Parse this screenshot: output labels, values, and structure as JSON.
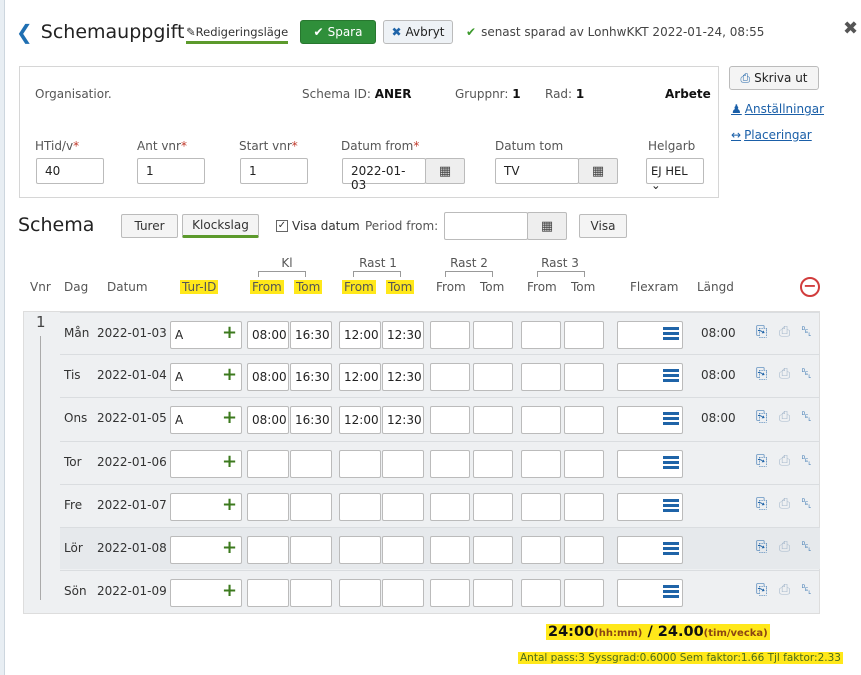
{
  "header": {
    "title": "Schemauppgift",
    "edit_mode": "Redigeringsläge",
    "save_label": "Spara",
    "cancel_label": "Avbryt",
    "saved_status": "senast sparad av LonhwKKT 2022-01-24, 08:55"
  },
  "info": {
    "org_label": "Organisatior.",
    "schema_id_label": "Schema ID:",
    "schema_id": "ANER",
    "gruppnr_label": "Gruppnr:",
    "gruppnr": "1",
    "rad_label": "Rad:",
    "rad": "1",
    "arbete": "Arbete",
    "htid_label": "HTid/v",
    "htid": "40",
    "antvnr_label": "Ant vnr",
    "antvnr": "1",
    "startvnr_label": "Start vnr",
    "startvnr": "1",
    "datum_from_label": "Datum from",
    "datum_from": "2022-01-03",
    "datum_tom_label": "Datum tom",
    "datum_tom": "TV",
    "helgarb_label": "Helgarb",
    "helgarb": "EJ HEL"
  },
  "side": {
    "print_label": "Skriva ut",
    "anst_label": "Anställningar",
    "plac_label": "Placeringar"
  },
  "schema": {
    "title": "Schema",
    "tab_turer": "Turer",
    "tab_klockslag": "Klockslag",
    "visa_datum": "Visa datum",
    "period_from": "Period from:",
    "visa_button": "Visa"
  },
  "columns": {
    "vnr": "Vnr",
    "dag": "Dag",
    "datum": "Datum",
    "turid": "Tur-ID",
    "kl": "Kl",
    "rast1": "Rast 1",
    "rast2": "Rast 2",
    "rast3": "Rast 3",
    "from": "From",
    "tom": "Tom",
    "flexram": "Flexram",
    "langd": "Längd"
  },
  "vnr_value": "1",
  "rows": [
    {
      "dag": "Mån",
      "datum": "2022-01-03",
      "tur": "A",
      "kl_from": "08:00",
      "kl_tom": "16:30",
      "r1_from": "12:00",
      "r1_tom": "12:30",
      "langd": "08:00"
    },
    {
      "dag": "Tis",
      "datum": "2022-01-04",
      "tur": "A",
      "kl_from": "08:00",
      "kl_tom": "16:30",
      "r1_from": "12:00",
      "r1_tom": "12:30",
      "langd": "08:00"
    },
    {
      "dag": "Ons",
      "datum": "2022-01-05",
      "tur": "A",
      "kl_from": "08:00",
      "kl_tom": "16:30",
      "r1_from": "12:00",
      "r1_tom": "12:30",
      "langd": "08:00"
    },
    {
      "dag": "Tor",
      "datum": "2022-01-06",
      "tur": "",
      "kl_from": "",
      "kl_tom": "",
      "r1_from": "",
      "r1_tom": "",
      "langd": ""
    },
    {
      "dag": "Fre",
      "datum": "2022-01-07",
      "tur": "",
      "kl_from": "",
      "kl_tom": "",
      "r1_from": "",
      "r1_tom": "",
      "langd": ""
    },
    {
      "dag": "Lör",
      "datum": "2022-01-08",
      "tur": "",
      "kl_from": "",
      "kl_tom": "",
      "r1_from": "",
      "r1_tom": "",
      "langd": ""
    },
    {
      "dag": "Sön",
      "datum": "2022-01-09",
      "tur": "",
      "kl_from": "",
      "kl_tom": "",
      "r1_from": "",
      "r1_tom": "",
      "langd": ""
    }
  ],
  "summary": {
    "hours": "24:00",
    "hours_unit": "(hh:mm)",
    "sep": "/",
    "decimal": "24.00",
    "decimal_unit": "(tim/vecka)",
    "stats": "Antal pass:3  Syssgrad:0.6000  Sem faktor:1.66  Tjl faktor:2.33"
  },
  "colors": {
    "accent": "#2f8f3a",
    "link": "#1a5fa8",
    "highlight": "#ffe81a"
  }
}
